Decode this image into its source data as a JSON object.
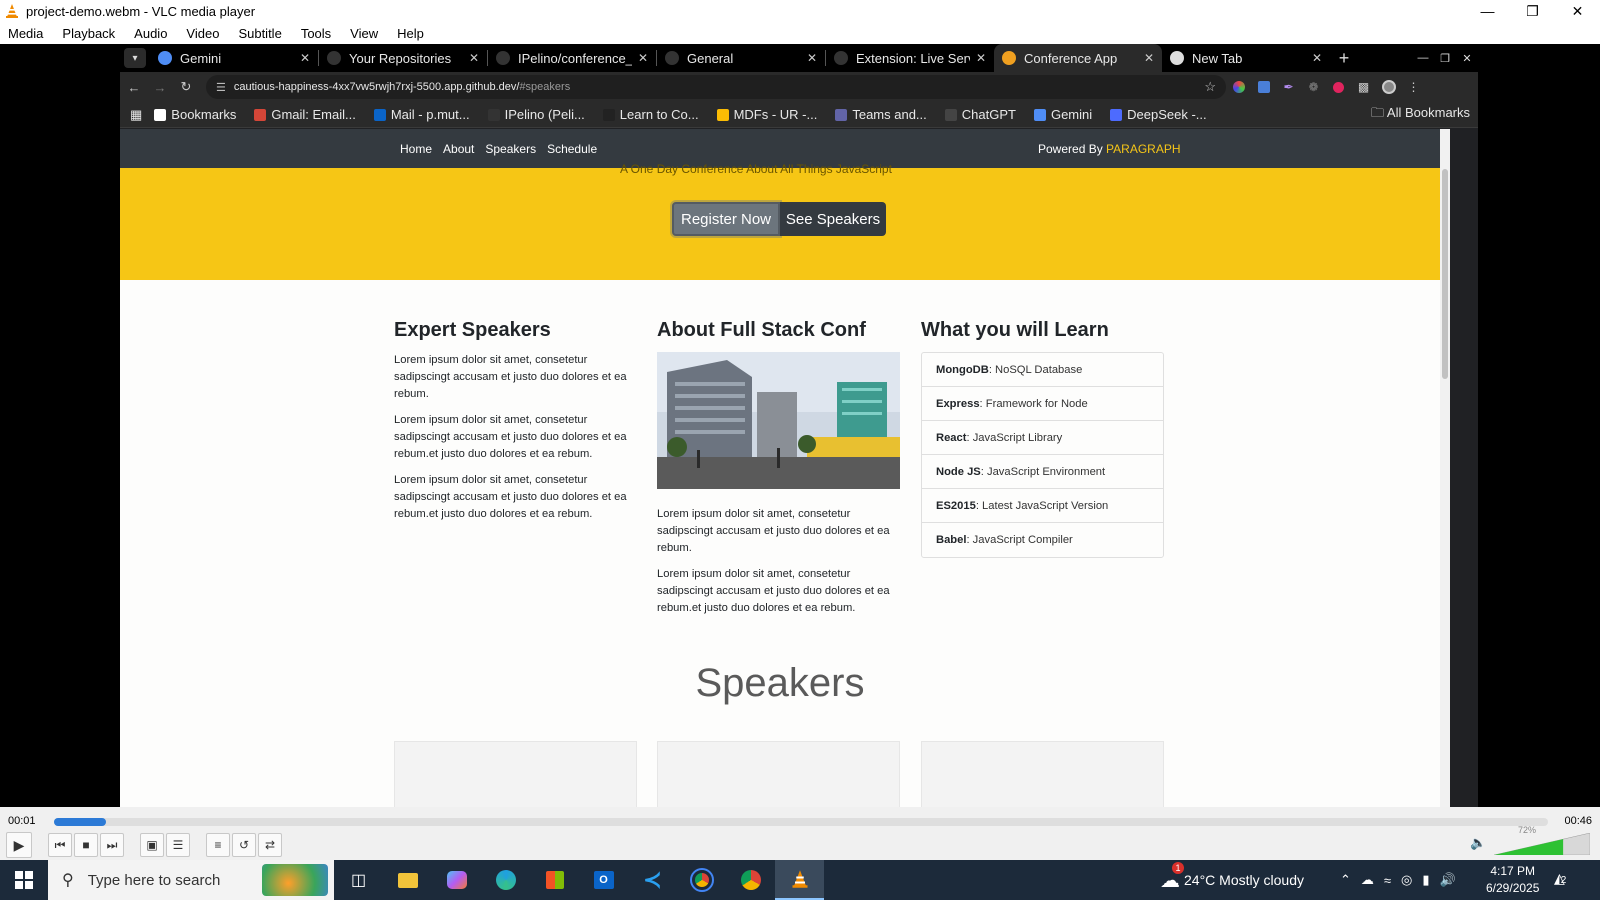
{
  "vlc": {
    "title": "project-demo.webm - VLC media player",
    "menu": [
      "Media",
      "Playback",
      "Audio",
      "Video",
      "Subtitle",
      "Tools",
      "View",
      "Help"
    ],
    "time_elapsed": "00:01",
    "time_total": "00:46",
    "progress": 0.035,
    "volume_label": "72%",
    "volume": 0.72
  },
  "browser": {
    "tabs": [
      {
        "label": "Gemini",
        "icon": "gemini-icon",
        "color": "#4f8df5"
      },
      {
        "label": "Your Repositories",
        "icon": "github-icon",
        "color": "#333333"
      },
      {
        "label": "IPelino/conference_r",
        "icon": "github-icon",
        "color": "#333333"
      },
      {
        "label": "General",
        "icon": "github-icon",
        "color": "#333333"
      },
      {
        "label": "Extension: Live Serv",
        "icon": "github-icon",
        "color": "#333333"
      },
      {
        "label": "Conference App",
        "icon": "conference-icon",
        "color": "#f0a020",
        "active": true
      },
      {
        "label": "New Tab",
        "icon": "chrome-icon",
        "color": "#dddddd"
      }
    ],
    "url_host": "cautious-happiness-4xx7vw5rwjh7rxj-5500.app.github.dev/",
    "url_path": "#speakers",
    "bookmarks": [
      {
        "label": "Bookmarks",
        "color": "#ffffff"
      },
      {
        "label": "Gmail: Email...",
        "color": "#d44638"
      },
      {
        "label": "Mail - p.mut...",
        "color": "#0a64c8"
      },
      {
        "label": "IPelino (Peli...",
        "color": "#333333"
      },
      {
        "label": "Learn to Co...",
        "color": "#222222"
      },
      {
        "label": "MDFs - UR -...",
        "color": "#fbbc04"
      },
      {
        "label": "Teams and...",
        "color": "#6264a7"
      },
      {
        "label": "ChatGPT",
        "color": "#444444"
      },
      {
        "label": "Gemini",
        "color": "#4f8df5"
      },
      {
        "label": "DeepSeek -...",
        "color": "#4d6bfe"
      }
    ],
    "all_bookmarks": "All Bookmarks"
  },
  "site": {
    "nav": [
      "Home",
      "About",
      "Speakers",
      "Schedule"
    ],
    "powered_by": "Powered By",
    "powered_brand": "PARAGRAPH",
    "hero_partial": "A One Day Conference About All Things JavaScript",
    "register_button": "Register Now",
    "speakers_button": "See Speakers",
    "expert": {
      "title": "Expert Speakers",
      "paragraphs": [
        "Lorem ipsum dolor sit amet, consetetur sadipscingt accusam et justo duo dolores et ea rebum.",
        "Lorem ipsum dolor sit amet, consetetur sadipscingt accusam et justo duo dolores et ea rebum.et justo duo dolores et ea rebum.",
        "Lorem ipsum dolor sit amet, consetetur sadipscingt accusam et justo duo dolores et ea rebum.et justo duo dolores et ea rebum."
      ]
    },
    "about": {
      "title": "About Full Stack Conf",
      "paragraphs": [
        "Lorem ipsum dolor sit amet, consetetur sadipscingt accusam et justo duo dolores et ea rebum.",
        "Lorem ipsum dolor sit amet, consetetur sadipscingt accusam et justo duo dolores et ea rebum.et justo duo dolores et ea rebum."
      ]
    },
    "learn": {
      "title": "What you will Learn",
      "items": [
        {
          "name": "MongoDB",
          "desc": ": NoSQL Database"
        },
        {
          "name": "Express",
          "desc": ": Framework for Node"
        },
        {
          "name": "React",
          "desc": ": JavaScript Library"
        },
        {
          "name": "Node JS",
          "desc": ": JavaScript Environment"
        },
        {
          "name": "ES2015",
          "desc": ": Latest JavaScript Version"
        },
        {
          "name": "Babel",
          "desc": ": JavaScript Compiler"
        }
      ]
    },
    "speakers_title": "Speakers"
  },
  "taskbar": {
    "search_placeholder": "Type here to search",
    "weather": "24°C  Mostly cloudy",
    "weather_badge": "1",
    "time": "4:17 PM",
    "date": "6/29/2025",
    "notifications": "2"
  },
  "colors": {
    "hero": "#f6c615",
    "nav": "#343a40",
    "accent": "#2c7ad6"
  }
}
